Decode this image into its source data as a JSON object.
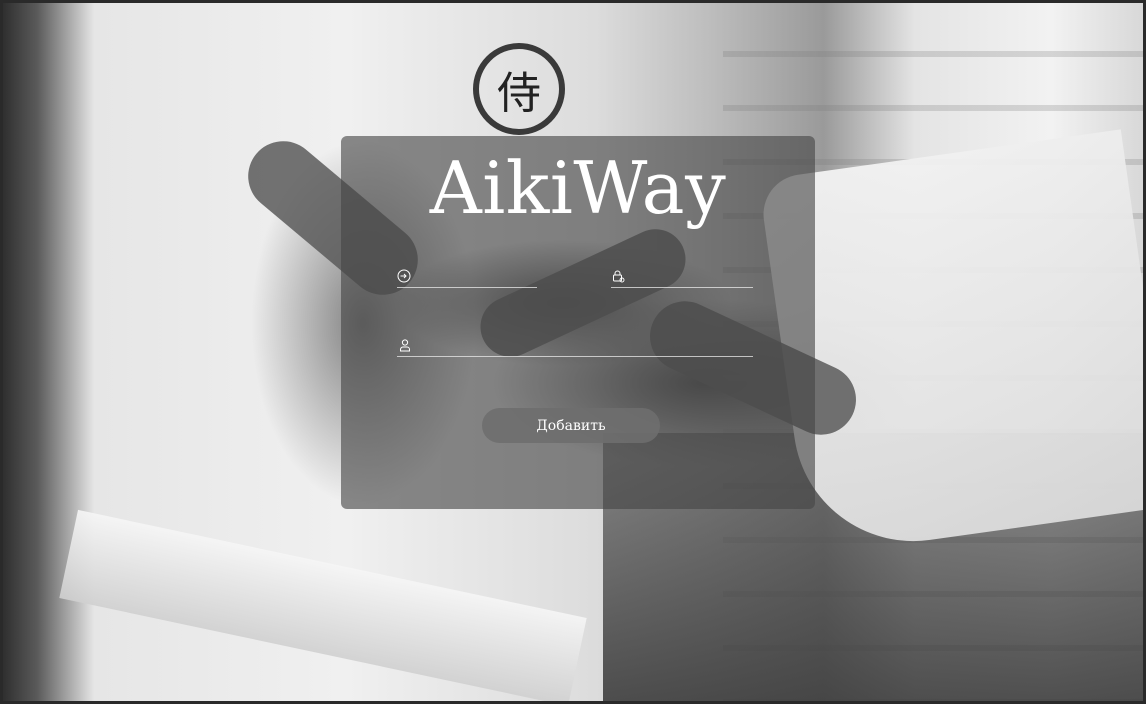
{
  "app": {
    "title": "AikiWay"
  },
  "form": {
    "login": {
      "value": "",
      "placeholder": "",
      "icon": "sign-in-icon"
    },
    "password": {
      "value": "",
      "placeholder": "",
      "icon": "lock-icon"
    },
    "name": {
      "value": "",
      "placeholder": "",
      "icon": "user-icon"
    },
    "submit_label": "Добавить"
  },
  "colors": {
    "card_overlay": "#464646",
    "button": "#6e6e6e",
    "text": "#ffffff"
  }
}
